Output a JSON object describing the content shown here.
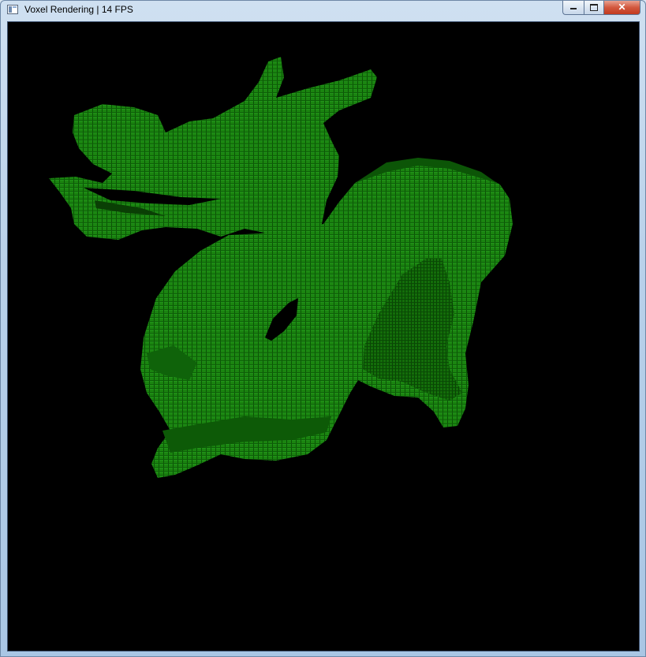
{
  "window": {
    "title": "Voxel Rendering | 14 FPS",
    "icon": "window-app-icon",
    "controls": {
      "minimize_icon": "minimize-icon",
      "maximize_icon": "maximize-icon",
      "close_label": "✕"
    }
  },
  "viewport": {
    "background": "#000000",
    "model": "dragon-voxel-model",
    "voxel_color_light": "#1f8a12",
    "voxel_color_mid": "#157a0b",
    "voxel_color_dark": "#0a4d05"
  }
}
